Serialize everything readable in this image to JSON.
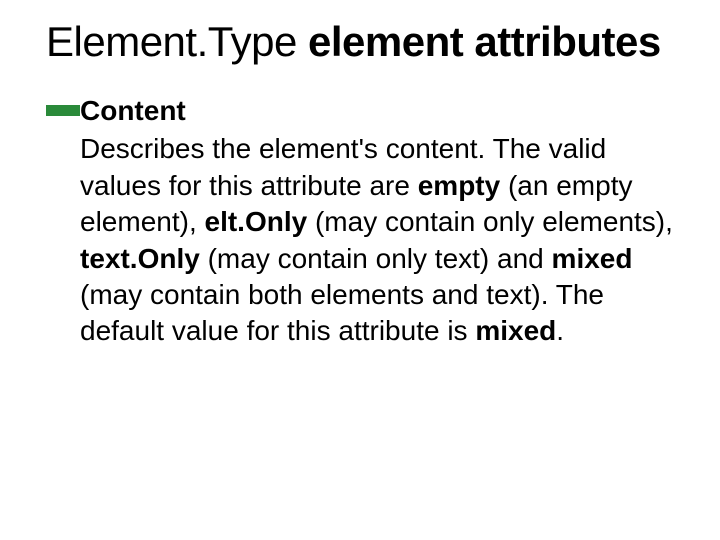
{
  "title": {
    "part1": "Element.Type",
    "part2": "element attributes"
  },
  "item": {
    "heading": "Content",
    "desc_lead": " Describes the element's content. The valid values for this attribute are ",
    "v1": "empty",
    "d1": " (an empty element), ",
    "v2": "elt.Only",
    "d2": " (may contain only elements), ",
    "v3": "text.Only",
    "d3": " (may contain only text) and ",
    "v4": "mixed",
    "d4": " (may contain both elements and text). The default value for this attribute is ",
    "v5": "mixed",
    "tail": "."
  }
}
